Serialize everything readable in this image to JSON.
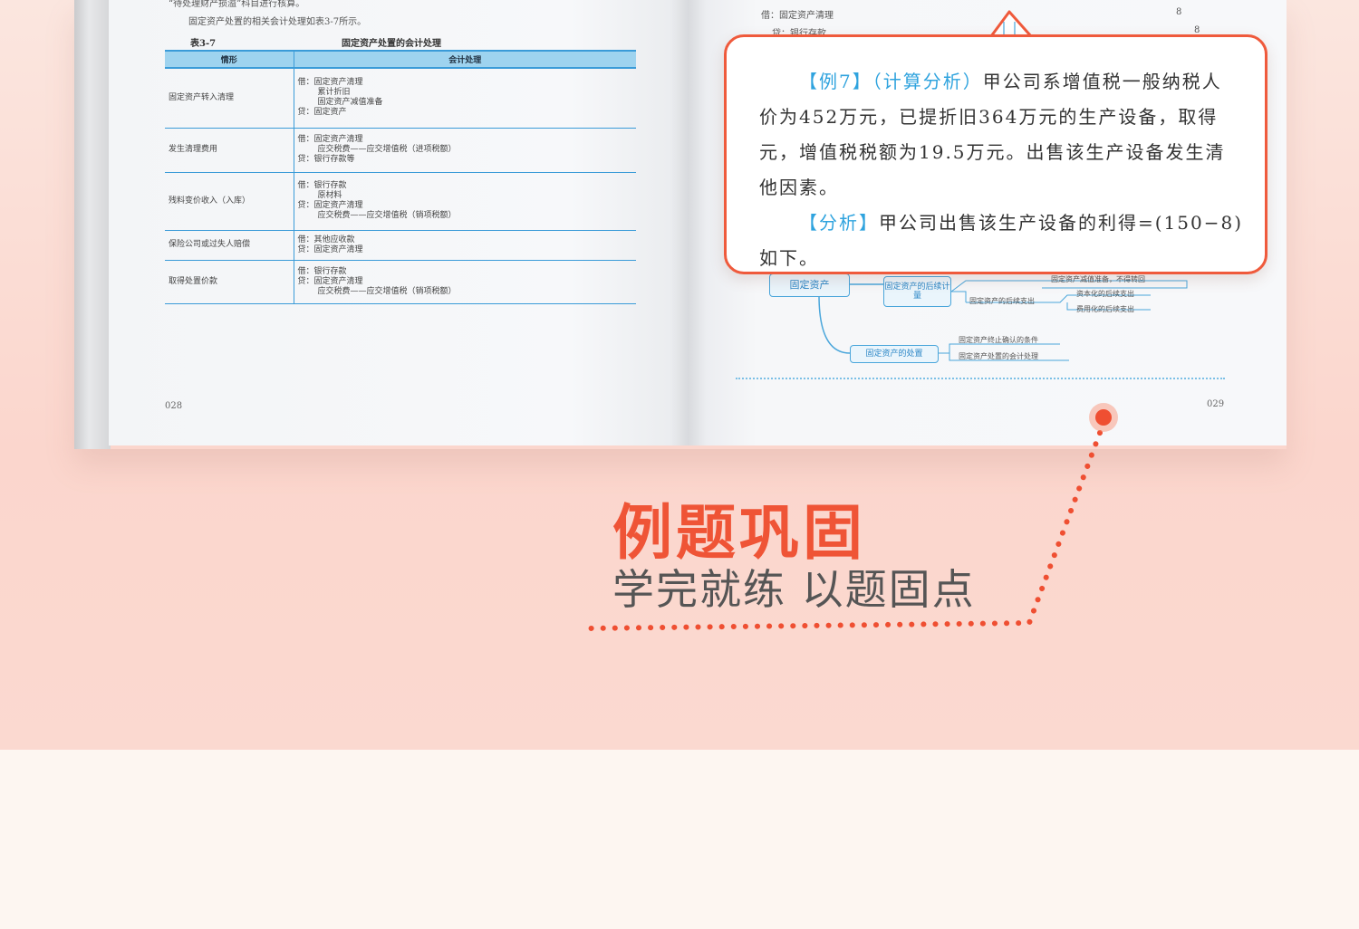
{
  "left_page": {
    "top_text_1": "“待处理财产损溢”科目进行核算。",
    "top_text_2": "固定资产处置的相关会计处理如表3-7所示。",
    "table_no": "表3-7",
    "table_title": "固定资产处置的会计处理",
    "columns": [
      "情形",
      "会计处理"
    ],
    "rows": [
      {
        "case": "固定资产转入清理",
        "lines": [
          "借：固定资产清理",
          "累计折旧",
          "固定资产减值准备",
          "贷：固定资产"
        ]
      },
      {
        "case": "发生清理费用",
        "lines": [
          "借：固定资产清理",
          "应交税费——应交增值税（进项税额）",
          "贷：银行存款等"
        ]
      },
      {
        "case": "残料变价收入（入库）",
        "lines": [
          "借：银行存款",
          "原材料",
          "贷：固定资产清理",
          "应交税费——应交增值税（销项税额）"
        ]
      },
      {
        "case": "保险公司或过失人赔偿",
        "lines": [
          "借：其他应收款",
          "贷：固定资产清理"
        ]
      },
      {
        "case": "取得处置价款",
        "lines": [
          "借：银行存款",
          "贷：固定资产清理",
          "应交税费——应交增值税（销项税额）"
        ]
      }
    ],
    "page_number": "028"
  },
  "right_page": {
    "top_line_1": "借：固定资产清理",
    "top_line_1_num": "8",
    "top_line_2": "贷：银行存款",
    "top_line_2_num": "8",
    "mindmap": {
      "root": "固定资产",
      "node_later": "固定资产的后续计量",
      "node_disposal": "固定资产的处置",
      "leaf_1": "固定资产的后续支出",
      "leaf_2": "资本化的后续支出",
      "leaf_3": "费用化的后续支出",
      "leaf_4": "固定资产终止确认的条件",
      "leaf_5": "固定资产处置的会计处理",
      "leaf_top": "固定资产减值准备，不得转回"
    },
    "page_number": "029"
  },
  "callout": {
    "tag_example": "【例7】",
    "tag_type": "（计算分析）",
    "line_1_rest": "甲公司系增值税一般纳税人",
    "line_2": "价为452万元，已提折旧364万元的生产设备，取得",
    "line_3": "元，增值税税额为19.5万元。出售该生产设备发生清",
    "line_4": "他因素。",
    "tag_analysis": "【分析】",
    "line_5_rest": "甲公司出售该生产设备的利得=(150−8)",
    "line_6": "如下。"
  },
  "headline": "例题巩固",
  "subline": "学完就练 以题固点",
  "colors": {
    "accent": "#ef5436",
    "blue": "#2fa3de",
    "table_blue": "#3a9bd8"
  }
}
